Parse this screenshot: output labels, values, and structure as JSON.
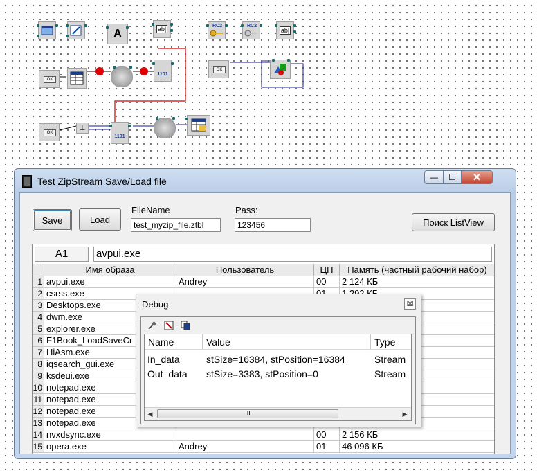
{
  "schema": {
    "ok_label": "OK",
    "rc2_label": "RC2",
    "edit_label": "ab|",
    "text_label": "A",
    "file_label": "1101"
  },
  "window": {
    "title": "Test ZipStream Save/Load file",
    "controls": {
      "minimize": "—",
      "maximize": "☐",
      "close": "✕"
    }
  },
  "form": {
    "save_label": "Save",
    "load_label": "Load",
    "filename_label": "FileName",
    "filename_value": "test_myzip_file.ztbl",
    "pass_label": "Pass:",
    "pass_value": "123456",
    "search_button": "Поиск ListView"
  },
  "grid": {
    "cell_ref": "A1",
    "formula": "avpui.exe",
    "headers": [
      "Имя образа",
      "Пользователь",
      "ЦП",
      "Память (частный рабочий набор)"
    ],
    "rows": [
      {
        "n": "1",
        "name": "avpui.exe",
        "user": "Andrey",
        "cpu": "00",
        "mem": "2 124 КБ"
      },
      {
        "n": "2",
        "name": "csrss.exe",
        "user": "",
        "cpu": "01",
        "mem": "1 292 КБ"
      },
      {
        "n": "3",
        "name": "Desktops.exe",
        "user": "",
        "cpu": "",
        "mem": ""
      },
      {
        "n": "4",
        "name": "dwm.exe",
        "user": "",
        "cpu": "",
        "mem": ""
      },
      {
        "n": "5",
        "name": "explorer.exe",
        "user": "",
        "cpu": "",
        "mem": ""
      },
      {
        "n": "6",
        "name": "F1Book_LoadSaveCr",
        "user": "",
        "cpu": "",
        "mem": ""
      },
      {
        "n": "7",
        "name": "HiAsm.exe",
        "user": "",
        "cpu": "",
        "mem": ""
      },
      {
        "n": "8",
        "name": "iqsearch_gui.exe",
        "user": "",
        "cpu": "",
        "mem": ""
      },
      {
        "n": "9",
        "name": "ksdeui.exe",
        "user": "",
        "cpu": "",
        "mem": ""
      },
      {
        "n": "10",
        "name": "notepad.exe",
        "user": "",
        "cpu": "",
        "mem": ""
      },
      {
        "n": "11",
        "name": "notepad.exe",
        "user": "",
        "cpu": "",
        "mem": ""
      },
      {
        "n": "12",
        "name": "notepad.exe",
        "user": "",
        "cpu": "",
        "mem": ""
      },
      {
        "n": "13",
        "name": "notepad.exe",
        "user": "",
        "cpu": "",
        "mem": ""
      },
      {
        "n": "14",
        "name": "nvxdsync.exe",
        "user": "",
        "cpu": "00",
        "mem": "2 156 КБ"
      },
      {
        "n": "15",
        "name": "opera.exe",
        "user": "Andrey",
        "cpu": "01",
        "mem": "46 096 КБ"
      }
    ]
  },
  "debug": {
    "title": "Debug",
    "close": "☒",
    "toolbar_icons": [
      "pin-icon",
      "clear-icon",
      "copy-icon"
    ],
    "columns": [
      "Name",
      "Value",
      "Type"
    ],
    "rows": [
      {
        "name": "In_data",
        "value": "stSize=16384, stPosition=16384",
        "type": "Stream"
      },
      {
        "name": "Out_data",
        "value": "stSize=3383, stPosition=0",
        "type": "Stream"
      }
    ],
    "scroll_grip": "III",
    "scroll_left": "◀",
    "scroll_right": "▶"
  },
  "colors": {
    "wire_red": "#d00000",
    "wire_blue": "#1a1a8c",
    "pin": "#1c6b6b",
    "window_frame": "#b9cde6",
    "titlebar_close": "#c24431"
  }
}
